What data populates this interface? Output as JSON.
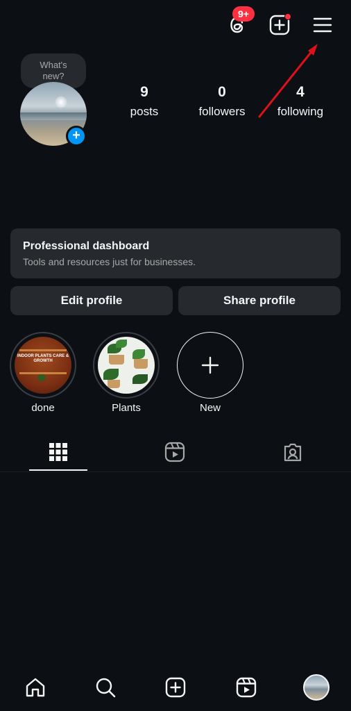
{
  "topbar": {
    "threads_badge": "9+",
    "icons": [
      "threads-icon",
      "create-icon",
      "menu-icon"
    ]
  },
  "profile": {
    "note_placeholder": "What's new?",
    "stats": [
      {
        "value": "9",
        "label": "posts"
      },
      {
        "value": "0",
        "label": "followers"
      },
      {
        "value": "4",
        "label": "following"
      }
    ]
  },
  "dashboard": {
    "title": "Professional dashboard",
    "subtitle": "Tools and resources just for businesses."
  },
  "buttons": {
    "edit": "Edit profile",
    "share": "Share profile"
  },
  "highlights": [
    {
      "label": "done",
      "cover_text": "INDOOR PLANTS CARE & GROWTH"
    },
    {
      "label": "Plants"
    },
    {
      "label": "New"
    }
  ],
  "tabs": [
    "grid-icon",
    "reels-icon",
    "tagged-icon"
  ],
  "bottom_nav": [
    "home-icon",
    "search-icon",
    "create-icon",
    "reels-icon",
    "profile-avatar"
  ],
  "colors": {
    "background": "#0c1014",
    "surface": "#262a2f",
    "accent_blue": "#0095f6",
    "badge_red": "#ff3040",
    "annotation_arrow": "#e0101a"
  }
}
